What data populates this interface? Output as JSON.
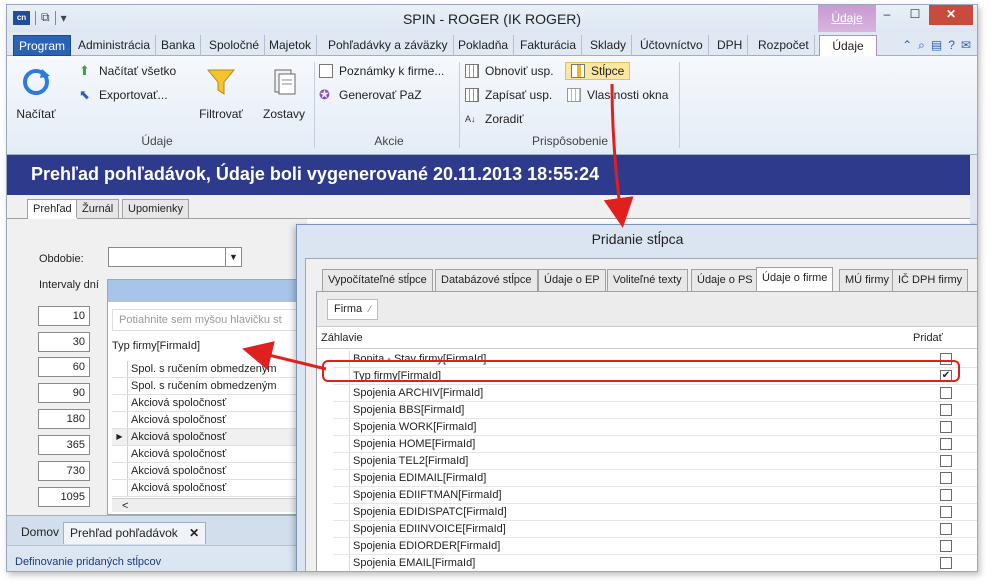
{
  "window": {
    "title": "SPIN - ROGER (IK ROGER)",
    "context_tab_header": "Údaje"
  },
  "tabs": [
    "Program",
    "Administrácia",
    "Banka",
    "Spoločné",
    "Majetok",
    "Pohľadávky a záväzky",
    "Pokladňa",
    "Fakturácia",
    "Sklady",
    "Účtovníctvo",
    "DPH",
    "Rozpočet",
    "Údaje"
  ],
  "ribbon": {
    "nacitat": "Načítať",
    "nacitat_vsetko": "Načítať všetko",
    "exportovat": "Exportovať...",
    "filtrovat": "Filtrovať",
    "zostavy": "Zostavy",
    "group_udaje": "Údaje",
    "poznamky": "Poznámky k firme...",
    "generovat": "Generovať PaZ",
    "group_akcie": "Akcie",
    "obnovit": "Obnoviť usp.",
    "zapisat": "Zapísať usp.",
    "zoradit": "Zoradiť",
    "stlpce": "Stĺpce",
    "vlastnosti": "Vlastnosti okna",
    "group_prisposobenie": "Prispôsobenie"
  },
  "header": {
    "title": "Prehľad pohľadávok,  Údaje boli vygenerované 20.11.2013 18:55:24"
  },
  "subtabs": [
    "Prehľad",
    "Žurnál",
    "Upomienky"
  ],
  "left": {
    "obdobie_label": "Obdobie:",
    "intervaly_label": "Intervaly dní",
    "intervals": [
      "10",
      "30",
      "60",
      "90",
      "180",
      "365",
      "730",
      "1095"
    ],
    "group_hint": "Potiahnite sem myšou hlavičku st",
    "column_header": "Typ firmy[FirmaId]",
    "rows": [
      "Spol. s ručením obmedzeným",
      "Spol. s ručením obmedzeným",
      "Akciová spoločnosť",
      "Akciová spoločnosť",
      "Akciová spoločnosť",
      "Akciová spoločnosť",
      "Akciová spoločnosť",
      "Akciová spoločnosť"
    ],
    "scroll_label": "<"
  },
  "bottom_tabs": {
    "domov": "Domov",
    "prehlad": "Prehľad pohľadávok",
    "close": "✕"
  },
  "status": "Definovanie pridaných stĺpcov",
  "dialog": {
    "title": "Pridanie stĺpca",
    "tabs": [
      "Vypočítateľné stĺpce",
      "Databázové stĺpce",
      "Údaje o EP",
      "Voliteľné texty",
      "Údaje o PS",
      "Údaje o firme",
      "MÚ firmy",
      "IČ DPH firmy"
    ],
    "group_chip": "Firma",
    "col_zahlavie": "Záhlavie",
    "col_pridat": "Pridať",
    "rows": [
      {
        "label": "Bonita - Stav firmy[FirmaId]",
        "checked": false
      },
      {
        "label": "Typ firmy[FirmaId]",
        "checked": true
      },
      {
        "label": "Spojenia ARCHIV[FirmaId]",
        "checked": false
      },
      {
        "label": "Spojenia BBS[FirmaId]",
        "checked": false
      },
      {
        "label": "Spojenia WORK[FirmaId]",
        "checked": false
      },
      {
        "label": "Spojenia HOME[FirmaId]",
        "checked": false
      },
      {
        "label": "Spojenia TEL2[FirmaId]",
        "checked": false
      },
      {
        "label": "Spojenia EDIMAIL[FirmaId]",
        "checked": false
      },
      {
        "label": "Spojenia EDIIFTMAN[FirmaId]",
        "checked": false
      },
      {
        "label": "Spojenia EDIDISPATC[FirmaId]",
        "checked": false
      },
      {
        "label": "Spojenia EDIINVOICE[FirmaId]",
        "checked": false
      },
      {
        "label": "Spojenia EDIORDER[FirmaId]",
        "checked": false
      },
      {
        "label": "Spojenia EMAIL[FirmaId]",
        "checked": false
      }
    ]
  },
  "colors": {
    "accent": "#2b63b4",
    "header_bar": "#2e3a8c",
    "highlight": "#e0201e"
  }
}
